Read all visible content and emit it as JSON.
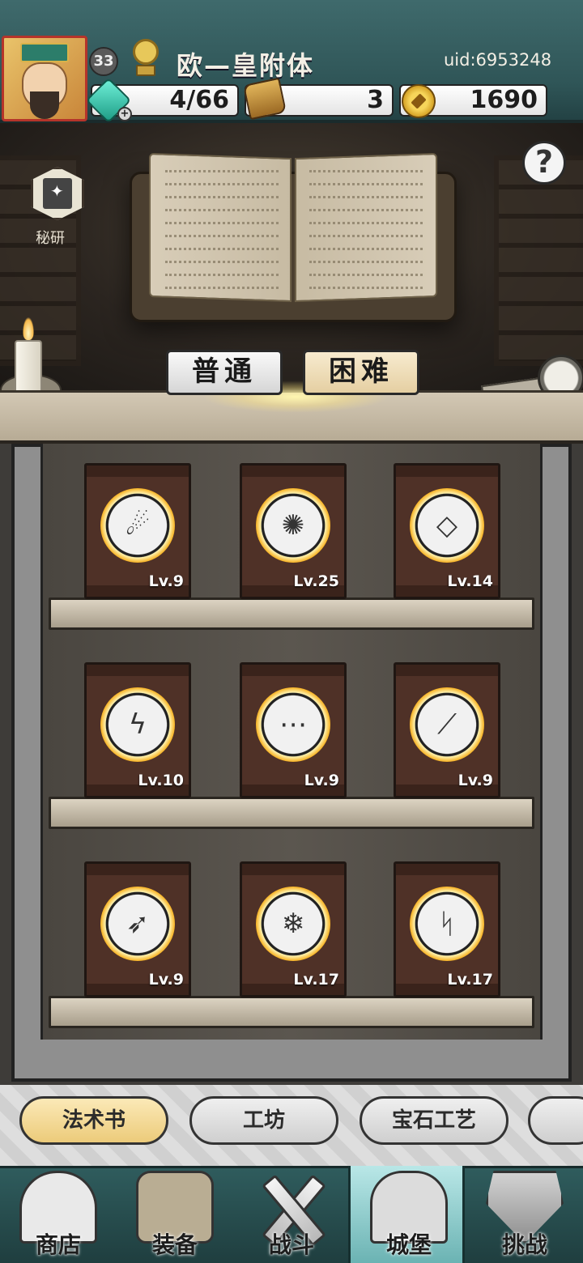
{
  "header": {
    "level": "33",
    "player_name": "欧—皇附体",
    "uid": "uid:6953248",
    "energy": "4/66",
    "scrolls": "3",
    "gold": "1690"
  },
  "scene": {
    "secret_label": "秘研",
    "help_symbol": "?",
    "difficulty": {
      "normal": "普通",
      "hard": "困难"
    }
  },
  "books": [
    {
      "icon": "meteor-drops-icon",
      "glyph": "☄",
      "level": "Lv.9"
    },
    {
      "icon": "splash-icon",
      "glyph": "✺",
      "level": "Lv.25"
    },
    {
      "icon": "crystal-block-icon",
      "glyph": "◇",
      "level": "Lv.14"
    },
    {
      "icon": "lightning-strike-icon",
      "glyph": "ϟ",
      "level": "Lv.10"
    },
    {
      "icon": "chain-icon",
      "glyph": "⋯",
      "level": "Lv.9"
    },
    {
      "icon": "blade-icon",
      "glyph": "⟋",
      "level": "Lv.9"
    },
    {
      "icon": "comet-icon",
      "glyph": "➶",
      "level": "Lv.9"
    },
    {
      "icon": "ice-shards-icon",
      "glyph": "❄",
      "level": "Lv.17"
    },
    {
      "icon": "zigzag-bolt-icon",
      "glyph": "ᛋ",
      "level": "Lv.17"
    }
  ],
  "tabs": [
    {
      "label": "法术书",
      "active": true
    },
    {
      "label": "工坊",
      "active": false
    },
    {
      "label": "宝石工艺",
      "active": false
    },
    {
      "label": "",
      "active": false
    }
  ],
  "nav": [
    {
      "label": "商店",
      "icon": "shop-icon"
    },
    {
      "label": "装备",
      "icon": "backpack-icon"
    },
    {
      "label": "战斗",
      "icon": "crossed-swords-icon"
    },
    {
      "label": "城堡",
      "icon": "castle-icon"
    },
    {
      "label": "挑战",
      "icon": "shield-icon"
    }
  ],
  "colors": {
    "accent_gold": "#f7b52a",
    "header_teal": "#2f5557",
    "active_tab": "#eccb7a"
  }
}
